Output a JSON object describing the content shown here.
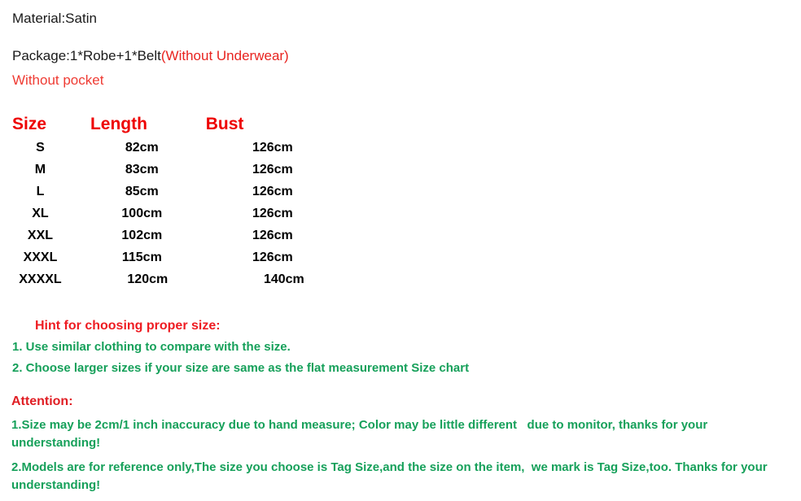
{
  "colors": {
    "red": "#ee0000",
    "red_alt": "#e8231f",
    "green": "#16a05a",
    "black": "#000000",
    "background": "#ffffff"
  },
  "intro": {
    "material": "Material:Satin",
    "package_black": "Package:1*Robe+1*Belt",
    "package_red": "(Without Underwear)",
    "pocket": "Without pocket"
  },
  "size_chart": {
    "headers": [
      "Size",
      "Length",
      "Bust"
    ],
    "rows": [
      {
        "size": "S",
        "length": "82cm",
        "bust": "126cm"
      },
      {
        "size": "M",
        "length": "83cm",
        "bust": "126cm"
      },
      {
        "size": "L",
        "length": "85cm",
        "bust": "126cm"
      },
      {
        "size": "XL",
        "length": "100cm",
        "bust": "126cm"
      },
      {
        "size": "XXL",
        "length": "102cm",
        "bust": "126cm"
      },
      {
        "size": "XXXL",
        "length": "115cm",
        "bust": "126cm"
      },
      {
        "size": "XXXXL",
        "length": "120cm",
        "bust": "140cm"
      }
    ]
  },
  "hint": {
    "title": "Hint for choosing proper size:",
    "items": [
      "1. Use similar clothing to compare with the size.",
      "2. Choose larger sizes if your size are same as the flat measurement Size chart"
    ]
  },
  "attention": {
    "title": "Attention:",
    "items": [
      "1.Size may be 2cm/1 inch inaccuracy due to hand measure; Color may be little different   due to monitor, thanks for your understanding!",
      "2.Models are for reference only,The size you choose is Tag Size,and the size on the item,  we mark is Tag Size,too. Thanks for your understanding!"
    ]
  }
}
